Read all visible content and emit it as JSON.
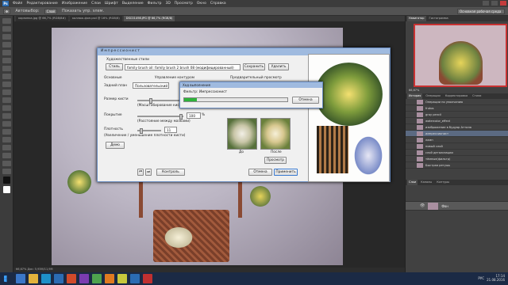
{
  "menu": {
    "logo": "Ps",
    "items": [
      "Файл",
      "Редактирование",
      "Изображение",
      "Слои",
      "Шрифт",
      "Выделение",
      "Фильтр",
      "3D",
      "Просмотр",
      "Окно",
      "Справка"
    ]
  },
  "options": {
    "mode": "Автовыбор:",
    "group": "Слой",
    "transform": "Показать упр. элем.",
    "workspace": "Основная рабочая среда"
  },
  "tabs": [
    {
      "label": "корзинка.jpg @ 66,7% (RGB/8#)",
      "active": false
    },
    {
      "label": "коллаж-фон.psd @ 16% (RGB/8)",
      "active": false
    },
    {
      "label": "DSC01498.JPG @ 66,7% (RGB/8)",
      "active": true
    }
  ],
  "status": "66,67%    Док: 5,93M/11,9M",
  "right_panel": {
    "nav_tabs": [
      "Навигатор",
      "Гистограмма"
    ],
    "zoom": "66,67%",
    "hist_tabs": [
      "История",
      "Операции",
      "Корректировка",
      "Стили"
    ],
    "history": [
      "Операции по умолчанию",
      "frutos",
      "gray pencil",
      "watercolor_effect",
      "изображение в будуар Аттила",
      "импрессионист",
      "ламп",
      "новый слой",
      "слой детализации",
      "тёмные(фильтр)",
      "Быстрая ретушь"
    ],
    "layer_tabs": [
      "Слои",
      "Каналы",
      "Контуры"
    ],
    "layer_name": "Фон"
  },
  "dialog": {
    "title": "Импрессионист",
    "artistic_styles": "Художественные стили",
    "style_btn": "Стиль",
    "style_value": "family brush oil: family brush 2 brush 08 (модифицированный)",
    "save": "Сохранить",
    "delete": "Удалить",
    "tab_main": "Основные",
    "tab_control": "Управление контуром",
    "preview_label": "Предварительный просмотр",
    "background": "Задний план",
    "background_value": "Пользовательский",
    "brush_size": "Размер кисти",
    "brush_size_value": "174",
    "brush_scale": "(Масштабирование кисти)",
    "coverage": "Покрытие",
    "coverage_value": "100",
    "coverage_note": "(Расстояние между мазками)",
    "density": "Плотность",
    "density_value": "11",
    "density_note": "(Увеличение / уменьшение плотности кисти)",
    "demo": "Демо",
    "before": "До",
    "after": "После",
    "preview_btn": "Просмотр",
    "control": "Контроль",
    "cancel": "Отмена",
    "apply": "Применить",
    "percent": "%"
  },
  "progress": {
    "title": "Ход выполнения",
    "label": "Фильтр: Импрессионист",
    "cancel": "Отмена",
    "value": 0.12
  },
  "taskbar": {
    "time": "17:14",
    "date": "21.08.2016",
    "lang": "РУС"
  },
  "colors": {
    "accent": "#2b6cb3",
    "progress": "#2eb33a",
    "selected_history": "#5b6a82"
  }
}
